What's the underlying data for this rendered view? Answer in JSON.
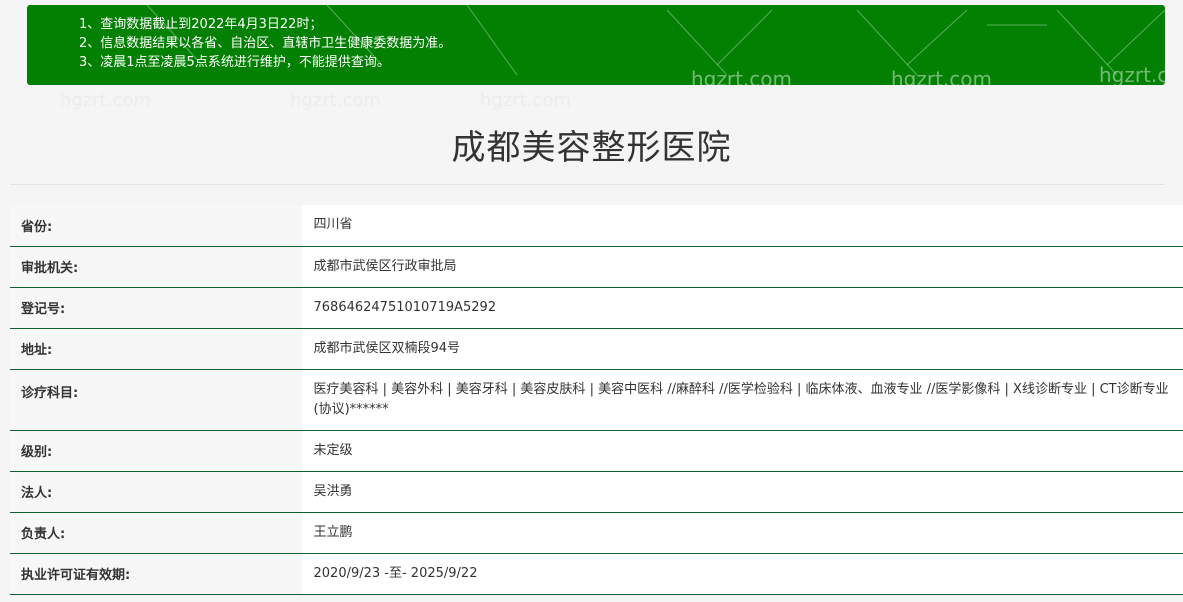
{
  "notice": {
    "lines": [
      "1、查询数据截止到2022年4月3日22时；",
      "2、信息数据结果以各省、自治区、直辖市卫生健康委数据为准。",
      "3、凌晨1点至凌晨5点系统进行维护，不能提供查询。"
    ]
  },
  "page": {
    "title": "成都美容整形医院"
  },
  "watermark": {
    "text": "hgzrt.com",
    "partial": "hgzrt.c"
  },
  "info_rows": [
    {
      "label": "省份:",
      "value": "四川省"
    },
    {
      "label": "审批机关:",
      "value": "成都市武侯区行政审批局"
    },
    {
      "label": "登记号:",
      "value": "76864624751010719A5292"
    },
    {
      "label": "地址:",
      "value": "成都市武侯区双楠段94号"
    },
    {
      "label": "诊疗科目:",
      "value": "医疗美容科 | 美容外科 | 美容牙科 | 美容皮肤科 | 美容中医科 //麻醉科 //医学检验科 | 临床体液、血液专业 //医学影像科 | X线诊断专业 | CT诊断专业(协议)******"
    },
    {
      "label": "级别:",
      "value": "未定级"
    },
    {
      "label": "法人:",
      "value": "吴洪勇"
    },
    {
      "label": "负责人:",
      "value": "王立鹏"
    },
    {
      "label": "执业许可证有效期:",
      "value": "2020/9/23 -至- 2025/9/22"
    }
  ],
  "colors": {
    "notice_bg": "#028002",
    "row_border": "#0f5f35",
    "label_bg": "#f7f7f7",
    "page_bg": "#f5f5f5"
  }
}
